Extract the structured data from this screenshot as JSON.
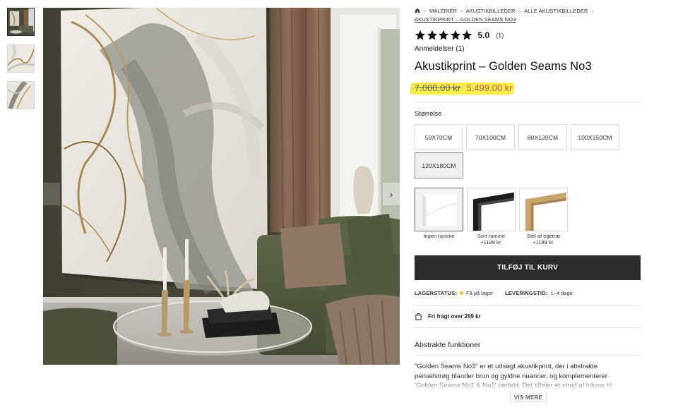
{
  "breadcrumb": {
    "items": [
      "MALERIER",
      "AKUSTIKBILLEDER",
      "ALLE AKUSTIKBILLEDER"
    ],
    "current": "AKUSTIKPRINT – GOLDEN SEAMS NO3"
  },
  "rating": {
    "score": "5.0",
    "count": "(1)",
    "stars": 5,
    "reviews_label": "Anmeldelser (1)"
  },
  "product": {
    "title": "Akustikprint – Golden Seams No3",
    "old_price": "7.000,00 kr",
    "new_price": "5.499,00 kr"
  },
  "sizes": {
    "label": "Størrelse",
    "options": [
      "50X70CM",
      "70X100CM",
      "80X120CM",
      "100X150CM",
      "120X180CM"
    ],
    "selected": "120X180CM"
  },
  "frames": [
    {
      "label": "Ingen ramme",
      "price": "",
      "icon": "no-frame-icon"
    },
    {
      "label": "Sort ramme",
      "price": "+1199 kr.",
      "icon": "black-frame-icon"
    },
    {
      "label": "Stel af egetræ",
      "price": "+1199 kr.",
      "icon": "oak-frame-icon"
    }
  ],
  "cart": {
    "button_label": "TILFØJ TIL KURV"
  },
  "stock": {
    "status_label": "LAGERSTATUS:",
    "status_value": "Få på lager",
    "delivery_label": "LEVERINGSTID:",
    "delivery_value": "1–4 dage",
    "status_color": "#f5c518"
  },
  "shipping": {
    "text": "Fri fragt over 299 kr"
  },
  "description": {
    "title": "Abstrakte funktioner",
    "text": "\"Golden Seams No3\" er et udsøgt akustikprint, der i abstrakte penselstrøg blander brun og gyldne nuancer, og komplementerer 'Golden Seams No1 & No2' perfekt. Det tilføjer et strejf af luksus til",
    "more_label": "VIS MERE"
  },
  "colors": {
    "accent_price": "#c45a5a",
    "highlight": "#f8ec3a",
    "button_bg": "#2b2b2b"
  }
}
